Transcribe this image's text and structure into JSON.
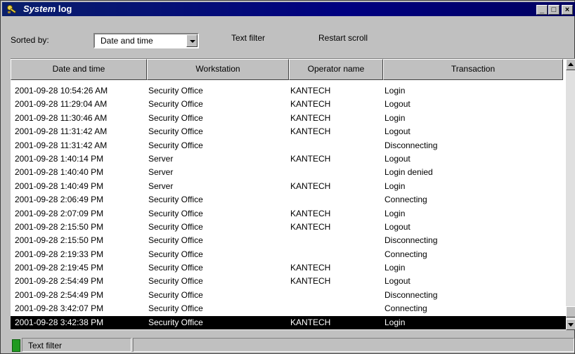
{
  "window": {
    "title_prefix": "System",
    "title_suffix": " log",
    "minimize": "_",
    "maximize": "□",
    "close": "×"
  },
  "toolbar": {
    "sorted_by_label": "Sorted by:",
    "sort_value": "Date and time",
    "text_filter_label": "Text filter",
    "restart_scroll_label": "Restart scroll"
  },
  "columns": [
    "Date and time",
    "Workstation",
    "Operator name",
    "Transaction"
  ],
  "rows": [
    {
      "date": "2001-09-28 10:54:26 AM",
      "ws": "Security Office",
      "op": "KANTECH",
      "tx": "Login"
    },
    {
      "date": "2001-09-28 11:29:04 AM",
      "ws": "Security Office",
      "op": "KANTECH",
      "tx": "Logout"
    },
    {
      "date": "2001-09-28 11:30:46 AM",
      "ws": "Security Office",
      "op": "KANTECH",
      "tx": "Login"
    },
    {
      "date": "2001-09-28 11:31:42 AM",
      "ws": "Security Office",
      "op": "KANTECH",
      "tx": "Logout"
    },
    {
      "date": "2001-09-28 11:31:42 AM",
      "ws": "Security Office",
      "op": "",
      "tx": "Disconnecting"
    },
    {
      "date": "2001-09-28 1:40:14 PM",
      "ws": "Server",
      "op": "KANTECH",
      "tx": "Logout"
    },
    {
      "date": "2001-09-28 1:40:40 PM",
      "ws": "Server",
      "op": "",
      "tx": "Login denied"
    },
    {
      "date": "2001-09-28 1:40:49 PM",
      "ws": "Server",
      "op": "KANTECH",
      "tx": "Login"
    },
    {
      "date": "2001-09-28 2:06:49 PM",
      "ws": "Security Office",
      "op": "",
      "tx": "Connecting"
    },
    {
      "date": "2001-09-28 2:07:09 PM",
      "ws": "Security Office",
      "op": "KANTECH",
      "tx": "Login"
    },
    {
      "date": "2001-09-28 2:15:50 PM",
      "ws": "Security Office",
      "op": "KANTECH",
      "tx": "Logout"
    },
    {
      "date": "2001-09-28 2:15:50 PM",
      "ws": "Security Office",
      "op": "",
      "tx": "Disconnecting"
    },
    {
      "date": "2001-09-28 2:19:33 PM",
      "ws": "Security Office",
      "op": "",
      "tx": "Connecting"
    },
    {
      "date": "2001-09-28 2:19:45 PM",
      "ws": "Security Office",
      "op": "KANTECH",
      "tx": "Login"
    },
    {
      "date": "2001-09-28 2:54:49 PM",
      "ws": "Security Office",
      "op": "KANTECH",
      "tx": "Logout"
    },
    {
      "date": "2001-09-28 2:54:49 PM",
      "ws": "Security Office",
      "op": "",
      "tx": "Disconnecting"
    },
    {
      "date": "2001-09-28 3:42:07 PM",
      "ws": "Security Office",
      "op": "",
      "tx": "Connecting"
    },
    {
      "date": "2001-09-28 3:42:38 PM",
      "ws": "Security Office",
      "op": "KANTECH",
      "tx": "Login",
      "selected": true
    }
  ],
  "status": {
    "text_filter_label": "Text filter",
    "indicator_color": "#1f9a1f"
  },
  "icons": {
    "window_icon": "key-icon",
    "scroll_up": "arrow-up-icon",
    "scroll_down": "arrow-down-icon"
  }
}
